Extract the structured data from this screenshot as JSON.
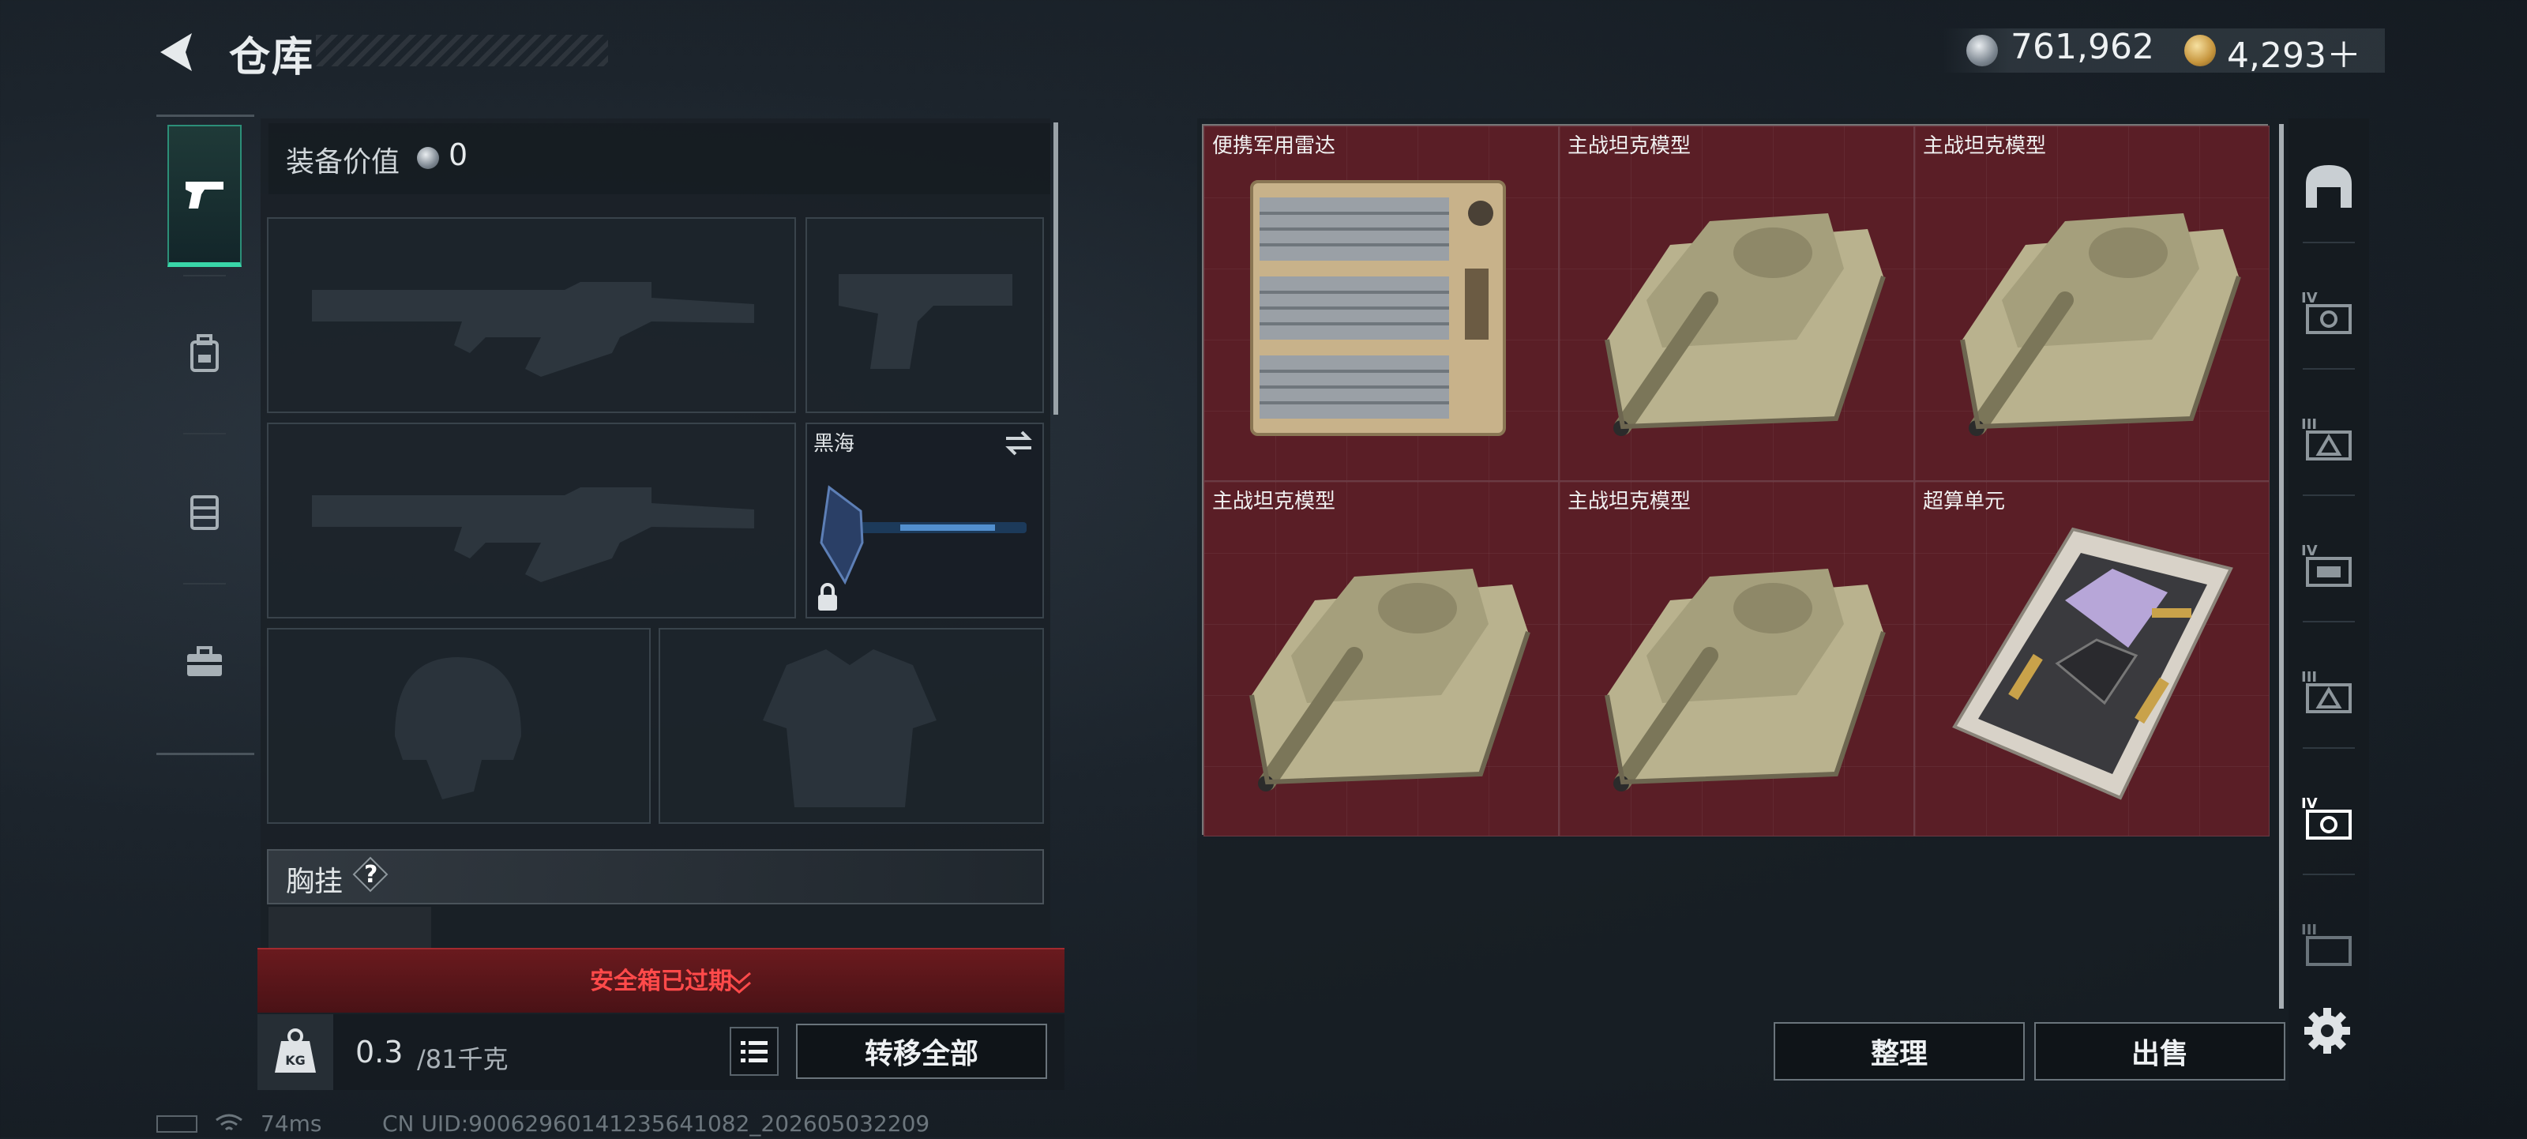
{
  "header": {
    "title": "仓库",
    "currency_1": "761,962",
    "currency_2": "4,293＋"
  },
  "equipment": {
    "value_label": "装备价值",
    "value": "0",
    "melee_name": "黑海",
    "chest_label": "胸挂",
    "chest_help": "?"
  },
  "safebox": {
    "status": "安全箱已过期"
  },
  "capacity": {
    "weight": "0.3",
    "unit": "/81千克",
    "transfer_all": "转移全部"
  },
  "stash": {
    "items": [
      {
        "name": "便携军用雷达",
        "icon": "radar-icon"
      },
      {
        "name": "主战坦克模型",
        "icon": "tank-icon"
      },
      {
        "name": "主战坦克模型",
        "icon": "tank-icon"
      },
      {
        "name": "主战坦克模型",
        "icon": "tank-icon"
      },
      {
        "name": "主战坦克模型",
        "icon": "tank-icon"
      },
      {
        "name": "超算单元",
        "icon": "chip-icon"
      }
    ],
    "sort_button": "整理",
    "sell_button": "出售"
  },
  "footer": {
    "ping": "74ms",
    "uid": "CN UID:9006296014123564108​2_202605032209"
  },
  "colors": {
    "accent": "#39d6a8",
    "warning": "#ff4a4a",
    "stash_cell": "#5a1e26"
  }
}
